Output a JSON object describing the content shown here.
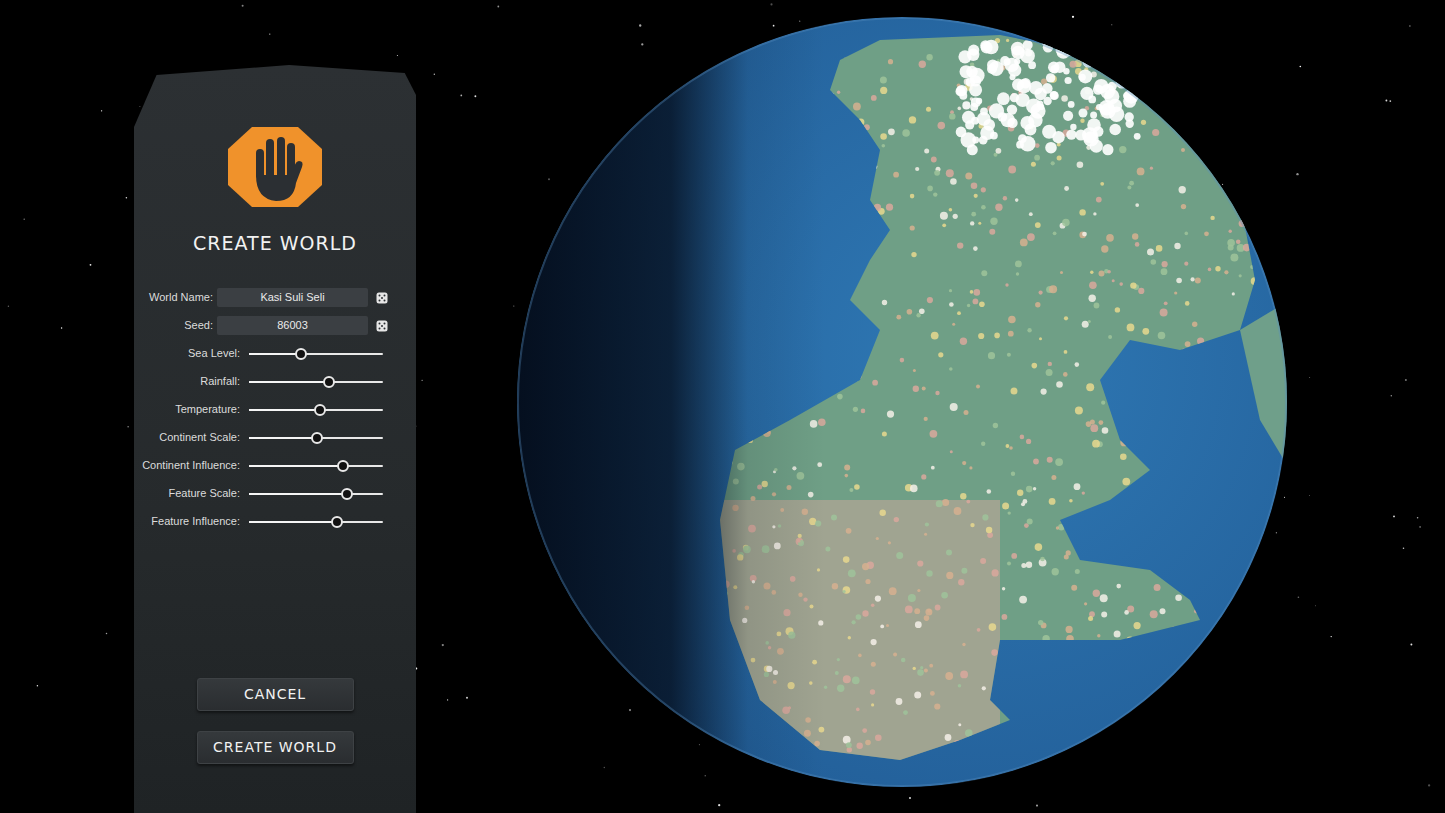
{
  "panel": {
    "title": "CREATE WORLD"
  },
  "fields": [
    {
      "label": "World Name:",
      "value": "Kasi Suli Seli"
    },
    {
      "label": "Seed:",
      "value": "86003"
    }
  ],
  "sliders": [
    {
      "label": "Sea Level:",
      "level": 0.39
    },
    {
      "label": "Rainfall:",
      "level": 0.6
    },
    {
      "label": "Temperature:",
      "level": 0.53
    },
    {
      "label": "Continent Scale:",
      "level": 0.51
    },
    {
      "label": "Continent Influence:",
      "level": 0.7
    },
    {
      "label": "Feature Scale:",
      "level": 0.73
    },
    {
      "label": "Feature Influence:",
      "level": 0.66
    }
  ],
  "buttons": [
    {
      "label": "CANCEL"
    },
    {
      "label": "CREATE WORLD"
    }
  ]
}
